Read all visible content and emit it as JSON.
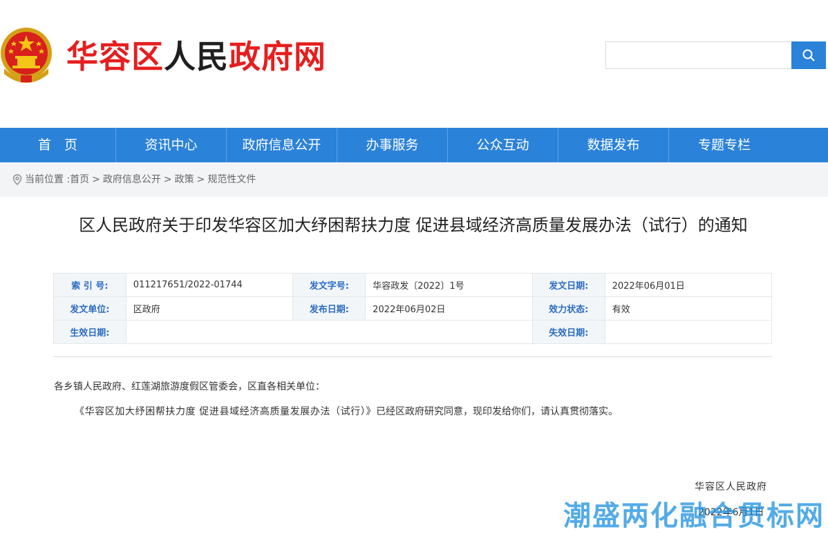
{
  "header": {
    "site_title_part1": "华容区",
    "site_title_part2": "人民",
    "site_title_part3": "政府网",
    "search_placeholder": "",
    "search_icon": "search-icon",
    "emblem_icon": "national-emblem-icon"
  },
  "nav": {
    "items": [
      "首　页",
      "资讯中心",
      "政府信息公开",
      "办事服务",
      "公众互动",
      "数据发布",
      "专题专栏"
    ]
  },
  "breadcrumb": {
    "prefix": "当前位置 :",
    "items": [
      "首页",
      "政府信息公开",
      "政策",
      "规范性文件"
    ],
    "separator": ">"
  },
  "article": {
    "title": "区人民政府关于印发华容区加大纾困帮扶力度 促进县域经济高质量发展办法（试行）的通知"
  },
  "meta": {
    "index_label": "索 引 号:",
    "index_value": "011217651/2022-01744",
    "doc_no_label": "发文字号:",
    "doc_no_value": "华容政发〔2022〕1号",
    "issue_date_label": "发文日期:",
    "issue_date_value": "2022年06月01日",
    "issuer_label": "发文单位:",
    "issuer_value": "区政府",
    "publish_date_label": "发布日期:",
    "publish_date_value": "2022年06月02日",
    "status_label": "效力状态:",
    "status_value": "有效",
    "effective_date_label": "生效日期:",
    "effective_date_value": "",
    "expire_date_label": "失效日期:",
    "expire_date_value": ""
  },
  "body": {
    "salutation": "各乡镇人民政府、红莲湖旅游度假区管委会，区直各相关单位：",
    "para_quoted": "《华容区加大纾困帮扶力度 促进县域经济高质量发展办法（试行）》",
    "para_rest": "已经区政府研究同意，现印发给你们，请认真贯彻落实。",
    "sign_org": "华容区人民政府",
    "sign_date": "2022年6月1日"
  },
  "watermark": "潮盛两化融合贯标网",
  "colors": {
    "brand_blue": "#2b82d9",
    "title_red": "#e61e1e",
    "label_blue": "#2b6cc4"
  }
}
